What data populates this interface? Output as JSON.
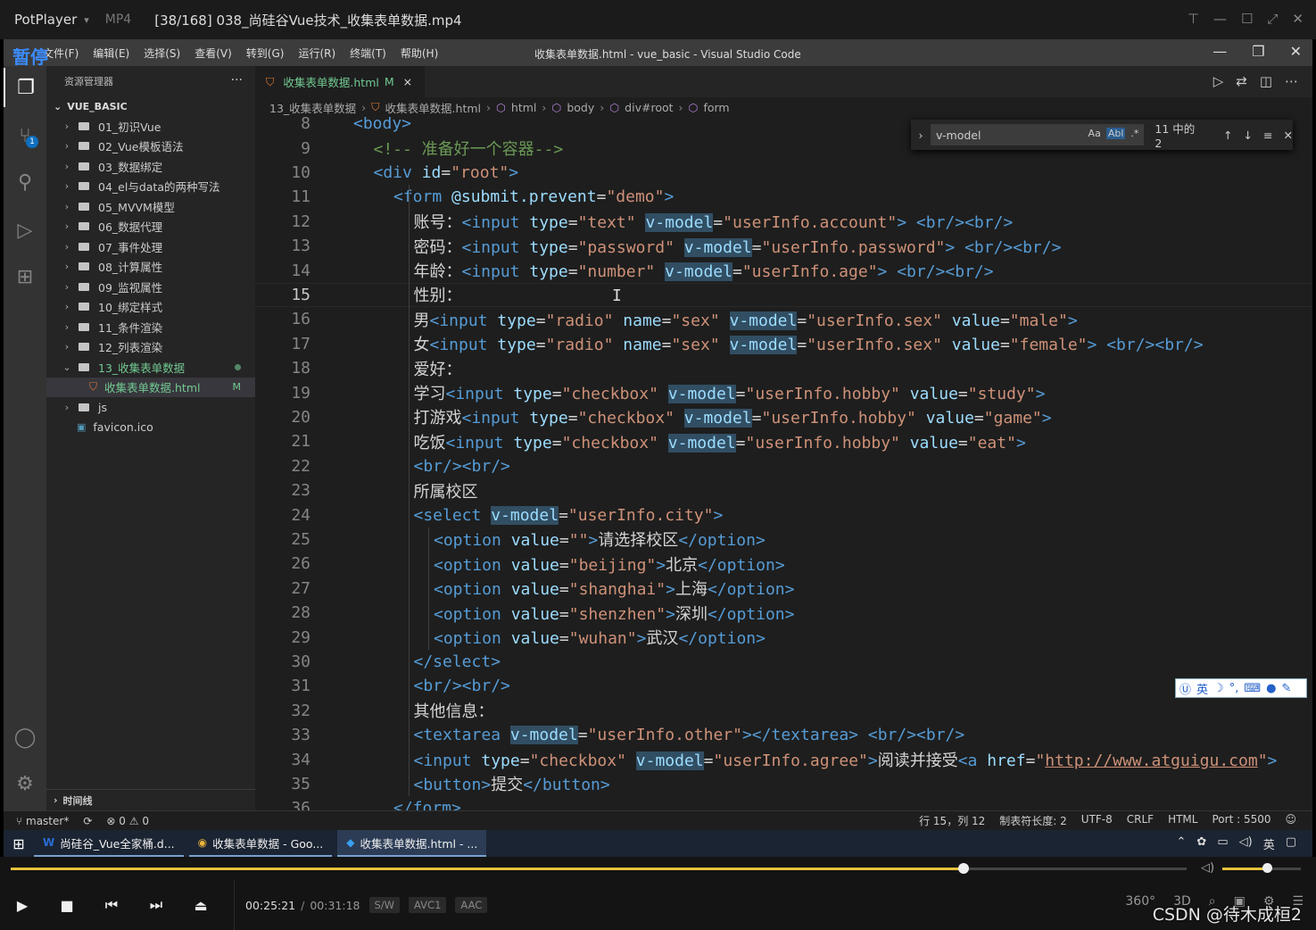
{
  "player": {
    "brand": "PotPlayer",
    "format": "MP4",
    "file_title": "[38/168] 038_尚硅谷Vue技术_收集表单数据.mp4",
    "paused_badge": "暂停",
    "time_current": "00:25:21",
    "time_separator": "/",
    "time_total": "00:31:18",
    "chips": [
      "S/W",
      "AVC1",
      "AAC"
    ],
    "progress_fraction": 0.81,
    "volume_fraction": 0.57,
    "right_controls": [
      "360°",
      "3D"
    ],
    "watermark": "CSDN @待木成桓2"
  },
  "vscode": {
    "menus": [
      "文件(F)",
      "编辑(E)",
      "选择(S)",
      "查看(V)",
      "转到(G)",
      "运行(R)",
      "终端(T)",
      "帮助(H)"
    ],
    "window_title": "收集表单数据.html - vue_basic - Visual Studio Code",
    "explorer": {
      "header": "资源管理器",
      "more": "···",
      "section": "VUE_BASIC",
      "items": [
        {
          "label": "01_初识Vue",
          "type": "folder"
        },
        {
          "label": "02_Vue模板语法",
          "type": "folder"
        },
        {
          "label": "03_数据绑定",
          "type": "folder"
        },
        {
          "label": "04_el与data的两种写法",
          "type": "folder"
        },
        {
          "label": "05_MVVM模型",
          "type": "folder"
        },
        {
          "label": "06_数据代理",
          "type": "folder"
        },
        {
          "label": "07_事件处理",
          "type": "folder"
        },
        {
          "label": "08_计算属性",
          "type": "folder"
        },
        {
          "label": "09_监视属性",
          "type": "folder"
        },
        {
          "label": "10_绑定样式",
          "type": "folder"
        },
        {
          "label": "11_条件渲染",
          "type": "folder"
        },
        {
          "label": "12_列表渲染",
          "type": "folder"
        },
        {
          "label": "13_收集表单数据",
          "type": "folder-open"
        },
        {
          "label": "收集表单数据.html",
          "type": "file",
          "status": "M"
        },
        {
          "label": "js",
          "type": "folder"
        },
        {
          "label": "favicon.ico",
          "type": "ico"
        }
      ],
      "timeline": "时间线"
    },
    "tab": {
      "label": "收集表单数据.html",
      "status": "M",
      "close": "×"
    },
    "breadcrumb": [
      "13_收集表单数据",
      "收集表单数据.html",
      "html",
      "body",
      "div#root",
      "form"
    ],
    "find": {
      "query": "v-model",
      "opt_case": "Aa",
      "opt_word": "Abl",
      "opt_regex": ".*",
      "count": "11 中的 2"
    },
    "ime": "英",
    "status_left": {
      "branch": "master*",
      "errors": "⊗ 0",
      "warnings": "⚠ 0"
    },
    "status_right": [
      "行 15，列 12",
      "制表符长度: 2",
      "UTF-8",
      "CRLF",
      "HTML",
      "Port : 5500"
    ]
  },
  "code_lines": [
    {
      "n": "8",
      "indent": 0,
      "segs": [
        {
          "c": "tag",
          "t": "<body>"
        }
      ]
    },
    {
      "n": "9",
      "indent": 1,
      "segs": [
        {
          "c": "cmt",
          "t": "<!-- 准备好一个容器-->"
        }
      ]
    },
    {
      "n": "10",
      "indent": 1,
      "segs": [
        {
          "c": "tag",
          "t": "<div "
        },
        {
          "c": "attr",
          "t": "id"
        },
        {
          "c": "txt",
          "t": "="
        },
        {
          "c": "str",
          "t": "\"root\""
        },
        {
          "c": "tag",
          "t": ">"
        }
      ]
    },
    {
      "n": "11",
      "indent": 2,
      "segs": [
        {
          "c": "tag",
          "t": "<form "
        },
        {
          "c": "attr",
          "t": "@submit.prevent"
        },
        {
          "c": "txt",
          "t": "="
        },
        {
          "c": "str",
          "t": "\"demo\""
        },
        {
          "c": "tag",
          "t": ">"
        }
      ]
    },
    {
      "n": "12",
      "indent": 3,
      "segs": [
        {
          "c": "txt",
          "t": "账号："
        },
        {
          "c": "tag",
          "t": "<input "
        },
        {
          "c": "attr",
          "t": "type"
        },
        {
          "c": "txt",
          "t": "="
        },
        {
          "c": "str",
          "t": "\"text\""
        },
        {
          "c": "txt",
          "t": " "
        },
        {
          "c": "attr hl",
          "t": "v-model"
        },
        {
          "c": "txt",
          "t": "="
        },
        {
          "c": "str",
          "t": "\"userInfo.account\""
        },
        {
          "c": "tag",
          "t": ">"
        },
        {
          "c": "txt",
          "t": " "
        },
        {
          "c": "tag",
          "t": "<br/><br/>"
        }
      ]
    },
    {
      "n": "13",
      "indent": 3,
      "segs": [
        {
          "c": "txt",
          "t": "密码："
        },
        {
          "c": "tag",
          "t": "<input "
        },
        {
          "c": "attr",
          "t": "type"
        },
        {
          "c": "txt",
          "t": "="
        },
        {
          "c": "str",
          "t": "\"password\""
        },
        {
          "c": "txt",
          "t": " "
        },
        {
          "c": "attr hl",
          "t": "v-model"
        },
        {
          "c": "txt",
          "t": "="
        },
        {
          "c": "str",
          "t": "\"userInfo.password\""
        },
        {
          "c": "tag",
          "t": ">"
        },
        {
          "c": "txt",
          "t": " "
        },
        {
          "c": "tag",
          "t": "<br/><br/>"
        }
      ]
    },
    {
      "n": "14",
      "indent": 3,
      "segs": [
        {
          "c": "txt",
          "t": "年龄："
        },
        {
          "c": "tag",
          "t": "<input "
        },
        {
          "c": "attr",
          "t": "type"
        },
        {
          "c": "txt",
          "t": "="
        },
        {
          "c": "str",
          "t": "\"number\""
        },
        {
          "c": "txt",
          "t": " "
        },
        {
          "c": "attr hl",
          "t": "v-model"
        },
        {
          "c": "txt",
          "t": "="
        },
        {
          "c": "str",
          "t": "\"userInfo.age\""
        },
        {
          "c": "tag",
          "t": ">"
        },
        {
          "c": "txt",
          "t": " "
        },
        {
          "c": "tag",
          "t": "<br/><br/>"
        }
      ]
    },
    {
      "n": "15",
      "indent": 3,
      "cur": true,
      "segs": [
        {
          "c": "txt",
          "t": "性别："
        }
      ]
    },
    {
      "n": "16",
      "indent": 3,
      "segs": [
        {
          "c": "txt",
          "t": "男"
        },
        {
          "c": "tag",
          "t": "<input "
        },
        {
          "c": "attr",
          "t": "type"
        },
        {
          "c": "txt",
          "t": "="
        },
        {
          "c": "str",
          "t": "\"radio\""
        },
        {
          "c": "txt",
          "t": " "
        },
        {
          "c": "attr",
          "t": "name"
        },
        {
          "c": "txt",
          "t": "="
        },
        {
          "c": "str",
          "t": "\"sex\""
        },
        {
          "c": "txt",
          "t": " "
        },
        {
          "c": "attr hl",
          "t": "v-model"
        },
        {
          "c": "txt",
          "t": "="
        },
        {
          "c": "str",
          "t": "\"userInfo.sex\""
        },
        {
          "c": "txt",
          "t": " "
        },
        {
          "c": "attr",
          "t": "value"
        },
        {
          "c": "txt",
          "t": "="
        },
        {
          "c": "str",
          "t": "\"male\""
        },
        {
          "c": "tag",
          "t": ">"
        }
      ]
    },
    {
      "n": "17",
      "indent": 3,
      "segs": [
        {
          "c": "txt",
          "t": "女"
        },
        {
          "c": "tag",
          "t": "<input "
        },
        {
          "c": "attr",
          "t": "type"
        },
        {
          "c": "txt",
          "t": "="
        },
        {
          "c": "str",
          "t": "\"radio\""
        },
        {
          "c": "txt",
          "t": " "
        },
        {
          "c": "attr",
          "t": "name"
        },
        {
          "c": "txt",
          "t": "="
        },
        {
          "c": "str",
          "t": "\"sex\""
        },
        {
          "c": "txt",
          "t": " "
        },
        {
          "c": "attr hl",
          "t": "v-model"
        },
        {
          "c": "txt",
          "t": "="
        },
        {
          "c": "str",
          "t": "\"userInfo.sex\""
        },
        {
          "c": "txt",
          "t": " "
        },
        {
          "c": "attr",
          "t": "value"
        },
        {
          "c": "txt",
          "t": "="
        },
        {
          "c": "str",
          "t": "\"female\""
        },
        {
          "c": "tag",
          "t": ">"
        },
        {
          "c": "txt",
          "t": " "
        },
        {
          "c": "tag",
          "t": "<br/><br/>"
        }
      ]
    },
    {
      "n": "18",
      "indent": 3,
      "segs": [
        {
          "c": "txt",
          "t": "爱好："
        }
      ]
    },
    {
      "n": "19",
      "indent": 3,
      "segs": [
        {
          "c": "txt",
          "t": "学习"
        },
        {
          "c": "tag",
          "t": "<input "
        },
        {
          "c": "attr",
          "t": "type"
        },
        {
          "c": "txt",
          "t": "="
        },
        {
          "c": "str",
          "t": "\"checkbox\""
        },
        {
          "c": "txt",
          "t": " "
        },
        {
          "c": "attr hl",
          "t": "v-model"
        },
        {
          "c": "txt",
          "t": "="
        },
        {
          "c": "str",
          "t": "\"userInfo.hobby\""
        },
        {
          "c": "txt",
          "t": " "
        },
        {
          "c": "attr",
          "t": "value"
        },
        {
          "c": "txt",
          "t": "="
        },
        {
          "c": "str",
          "t": "\"study\""
        },
        {
          "c": "tag",
          "t": ">"
        }
      ]
    },
    {
      "n": "20",
      "indent": 3,
      "segs": [
        {
          "c": "txt",
          "t": "打游戏"
        },
        {
          "c": "tag",
          "t": "<input "
        },
        {
          "c": "attr",
          "t": "type"
        },
        {
          "c": "txt",
          "t": "="
        },
        {
          "c": "str",
          "t": "\"checkbox\""
        },
        {
          "c": "txt",
          "t": " "
        },
        {
          "c": "attr hl",
          "t": "v-model"
        },
        {
          "c": "txt",
          "t": "="
        },
        {
          "c": "str",
          "t": "\"userInfo.hobby\""
        },
        {
          "c": "txt",
          "t": " "
        },
        {
          "c": "attr",
          "t": "value"
        },
        {
          "c": "txt",
          "t": "="
        },
        {
          "c": "str",
          "t": "\"game\""
        },
        {
          "c": "tag",
          "t": ">"
        }
      ]
    },
    {
      "n": "21",
      "indent": 3,
      "segs": [
        {
          "c": "txt",
          "t": "吃饭"
        },
        {
          "c": "tag",
          "t": "<input "
        },
        {
          "c": "attr",
          "t": "type"
        },
        {
          "c": "txt",
          "t": "="
        },
        {
          "c": "str",
          "t": "\"checkbox\""
        },
        {
          "c": "txt",
          "t": " "
        },
        {
          "c": "attr hl",
          "t": "v-model"
        },
        {
          "c": "txt",
          "t": "="
        },
        {
          "c": "str",
          "t": "\"userInfo.hobby\""
        },
        {
          "c": "txt",
          "t": " "
        },
        {
          "c": "attr",
          "t": "value"
        },
        {
          "c": "txt",
          "t": "="
        },
        {
          "c": "str",
          "t": "\"eat\""
        },
        {
          "c": "tag",
          "t": ">"
        }
      ]
    },
    {
      "n": "22",
      "indent": 3,
      "segs": [
        {
          "c": "tag",
          "t": "<br/><br/>"
        }
      ]
    },
    {
      "n": "23",
      "indent": 3,
      "segs": [
        {
          "c": "txt",
          "t": "所属校区"
        }
      ]
    },
    {
      "n": "24",
      "indent": 3,
      "segs": [
        {
          "c": "tag",
          "t": "<select "
        },
        {
          "c": "attr hl",
          "t": "v-model"
        },
        {
          "c": "txt",
          "t": "="
        },
        {
          "c": "str",
          "t": "\"userInfo.city\""
        },
        {
          "c": "tag",
          "t": ">"
        }
      ]
    },
    {
      "n": "25",
      "indent": 4,
      "segs": [
        {
          "c": "tag",
          "t": "<option "
        },
        {
          "c": "attr",
          "t": "value"
        },
        {
          "c": "txt",
          "t": "="
        },
        {
          "c": "str",
          "t": "\"\""
        },
        {
          "c": "tag",
          "t": ">"
        },
        {
          "c": "txt",
          "t": "请选择校区"
        },
        {
          "c": "tag",
          "t": "</option>"
        }
      ]
    },
    {
      "n": "26",
      "indent": 4,
      "segs": [
        {
          "c": "tag",
          "t": "<option "
        },
        {
          "c": "attr",
          "t": "value"
        },
        {
          "c": "txt",
          "t": "="
        },
        {
          "c": "str",
          "t": "\"beijing\""
        },
        {
          "c": "tag",
          "t": ">"
        },
        {
          "c": "txt",
          "t": "北京"
        },
        {
          "c": "tag",
          "t": "</option>"
        }
      ]
    },
    {
      "n": "27",
      "indent": 4,
      "segs": [
        {
          "c": "tag",
          "t": "<option "
        },
        {
          "c": "attr",
          "t": "value"
        },
        {
          "c": "txt",
          "t": "="
        },
        {
          "c": "str",
          "t": "\"shanghai\""
        },
        {
          "c": "tag",
          "t": ">"
        },
        {
          "c": "txt",
          "t": "上海"
        },
        {
          "c": "tag",
          "t": "</option>"
        }
      ]
    },
    {
      "n": "28",
      "indent": 4,
      "segs": [
        {
          "c": "tag",
          "t": "<option "
        },
        {
          "c": "attr",
          "t": "value"
        },
        {
          "c": "txt",
          "t": "="
        },
        {
          "c": "str",
          "t": "\"shenzhen\""
        },
        {
          "c": "tag",
          "t": ">"
        },
        {
          "c": "txt",
          "t": "深圳"
        },
        {
          "c": "tag",
          "t": "</option>"
        }
      ]
    },
    {
      "n": "29",
      "indent": 4,
      "segs": [
        {
          "c": "tag",
          "t": "<option "
        },
        {
          "c": "attr",
          "t": "value"
        },
        {
          "c": "txt",
          "t": "="
        },
        {
          "c": "str",
          "t": "\"wuhan\""
        },
        {
          "c": "tag",
          "t": ">"
        },
        {
          "c": "txt",
          "t": "武汉"
        },
        {
          "c": "tag",
          "t": "</option>"
        }
      ]
    },
    {
      "n": "30",
      "indent": 3,
      "segs": [
        {
          "c": "tag",
          "t": "</select>"
        }
      ]
    },
    {
      "n": "31",
      "indent": 3,
      "segs": [
        {
          "c": "tag",
          "t": "<br/><br/>"
        }
      ]
    },
    {
      "n": "32",
      "indent": 3,
      "segs": [
        {
          "c": "txt",
          "t": "其他信息："
        }
      ]
    },
    {
      "n": "33",
      "indent": 3,
      "segs": [
        {
          "c": "tag",
          "t": "<textarea "
        },
        {
          "c": "attr hl",
          "t": "v-model"
        },
        {
          "c": "txt",
          "t": "="
        },
        {
          "c": "str",
          "t": "\"userInfo.other\""
        },
        {
          "c": "tag",
          "t": "></textarea>"
        },
        {
          "c": "txt",
          "t": " "
        },
        {
          "c": "tag",
          "t": "<br/><br/>"
        }
      ]
    },
    {
      "n": "34",
      "indent": 3,
      "segs": [
        {
          "c": "tag",
          "t": "<input "
        },
        {
          "c": "attr",
          "t": "type"
        },
        {
          "c": "txt",
          "t": "="
        },
        {
          "c": "str",
          "t": "\"checkbox\""
        },
        {
          "c": "txt",
          "t": " "
        },
        {
          "c": "attr hl",
          "t": "v-model"
        },
        {
          "c": "txt",
          "t": "="
        },
        {
          "c": "str",
          "t": "\"userInfo.agree\""
        },
        {
          "c": "tag",
          "t": ">"
        },
        {
          "c": "txt",
          "t": "阅读并接受"
        },
        {
          "c": "tag",
          "t": "<a "
        },
        {
          "c": "attr",
          "t": "href"
        },
        {
          "c": "txt",
          "t": "="
        },
        {
          "c": "str",
          "t": "\""
        },
        {
          "c": "link",
          "t": "http://www.atguigu.com"
        },
        {
          "c": "str",
          "t": "\""
        },
        {
          "c": "tag",
          "t": ">"
        }
      ]
    },
    {
      "n": "35",
      "indent": 3,
      "segs": [
        {
          "c": "tag",
          "t": "<button>"
        },
        {
          "c": "txt",
          "t": "提交"
        },
        {
          "c": "tag",
          "t": "</button>"
        }
      ]
    },
    {
      "n": "36",
      "indent": 2,
      "segs": [
        {
          "c": "tag",
          "t": "</form>"
        }
      ]
    }
  ],
  "taskbar": {
    "items": [
      {
        "icon": "W",
        "label": "尚硅谷_Vue全家桶.d..."
      },
      {
        "icon": "◉",
        "label": "收集表单数据 - Goo..."
      },
      {
        "icon": "◆",
        "label": "收集表单数据.html - ..."
      }
    ],
    "ime": "英"
  }
}
